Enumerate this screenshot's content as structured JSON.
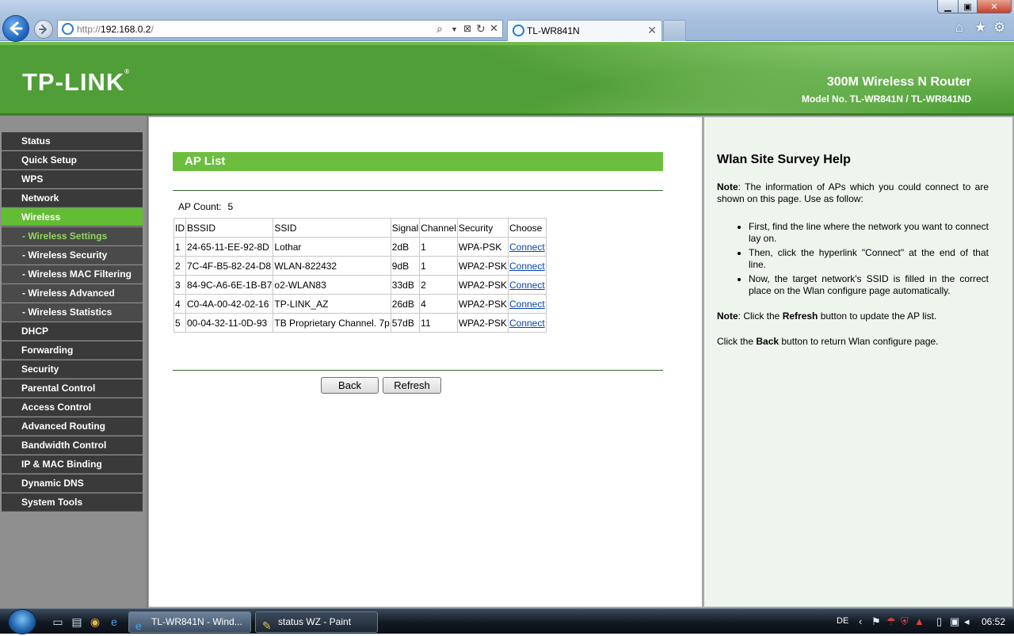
{
  "browser": {
    "address_prefix": "http://",
    "address_host": "192.168.0.2",
    "address_suffix": "/",
    "tab_title": "TL-WR841N",
    "close_glyph": "✕"
  },
  "header": {
    "logo": "TP-LINK",
    "product": "300M Wireless N Router",
    "model": "Model No. TL-WR841N / TL-WR841ND"
  },
  "sidebar": {
    "items": [
      {
        "label": "Status",
        "kind": "top"
      },
      {
        "label": "Quick Setup",
        "kind": "top"
      },
      {
        "label": "WPS",
        "kind": "top"
      },
      {
        "label": "Network",
        "kind": "top"
      },
      {
        "label": "Wireless",
        "kind": "active"
      },
      {
        "label": "- Wireless Settings",
        "kind": "sub-current"
      },
      {
        "label": "- Wireless Security",
        "kind": "sub"
      },
      {
        "label": "- Wireless MAC Filtering",
        "kind": "sub"
      },
      {
        "label": "- Wireless Advanced",
        "kind": "sub"
      },
      {
        "label": "- Wireless Statistics",
        "kind": "sub"
      },
      {
        "label": "DHCP",
        "kind": "top"
      },
      {
        "label": "Forwarding",
        "kind": "top"
      },
      {
        "label": "Security",
        "kind": "top"
      },
      {
        "label": "Parental Control",
        "kind": "top"
      },
      {
        "label": "Access Control",
        "kind": "top"
      },
      {
        "label": "Advanced Routing",
        "kind": "top"
      },
      {
        "label": "Bandwidth Control",
        "kind": "top"
      },
      {
        "label": "IP & MAC Binding",
        "kind": "top"
      },
      {
        "label": "Dynamic DNS",
        "kind": "top"
      },
      {
        "label": "System Tools",
        "kind": "top"
      }
    ]
  },
  "main": {
    "title": "AP List",
    "ap_count_label": "AP Count:",
    "ap_count": "5",
    "columns": [
      "ID",
      "BSSID",
      "SSID",
      "Signal",
      "Channel",
      "Security",
      "Choose"
    ],
    "rows": [
      [
        "1",
        "24-65-11-EE-92-8D",
        "Lothar",
        "2dB",
        "1",
        "WPA-PSK",
        "Connect"
      ],
      [
        "2",
        "7C-4F-B5-82-24-D8",
        "WLAN-822432",
        "9dB",
        "1",
        "WPA2-PSK",
        "Connect"
      ],
      [
        "3",
        "84-9C-A6-6E-1B-B7",
        "o2-WLAN83",
        "33dB",
        "2",
        "WPA2-PSK",
        "Connect"
      ],
      [
        "4",
        "C0-4A-00-42-02-16",
        "TP-LINK_AZ",
        "26dB",
        "4",
        "WPA2-PSK",
        "Connect"
      ],
      [
        "5",
        "00-04-32-11-0D-93",
        "TB Proprietary Channel. 7p",
        "57dB",
        "11",
        "WPA2-PSK",
        "Connect"
      ]
    ],
    "back_label": "Back",
    "refresh_label": "Refresh"
  },
  "help": {
    "title": "Wlan Site Survey Help",
    "note1_label": "Note",
    "note1_text": ": The information of APs which you could connect to are shown on this page. Use as follow:",
    "steps": [
      "First, find the line where the network you want to connect lay on.",
      "Then, click the hyperlink \"Connect\" at the end of that line.",
      "Now, the target network's SSID is filled in the correct place on the Wlan configure page automatically."
    ],
    "note2_label": "Note",
    "note2_pre": ": Click the ",
    "note2_bold": "Refresh",
    "note2_post": " button to update the AP list.",
    "back_pre": "Click the ",
    "back_bold": "Back",
    "back_post": " button to return Wlan configure page."
  },
  "taskbar": {
    "ie_task": "TL-WR841N - Wind...",
    "paint_task": "status WZ - Paint",
    "lang": "DE",
    "clock": "06:52"
  },
  "colors": {
    "tplink_green": "#4f9e37",
    "menu_active": "#62bd33",
    "title_bar": "#6cbe3e",
    "help_bg": "#eef5ed"
  }
}
